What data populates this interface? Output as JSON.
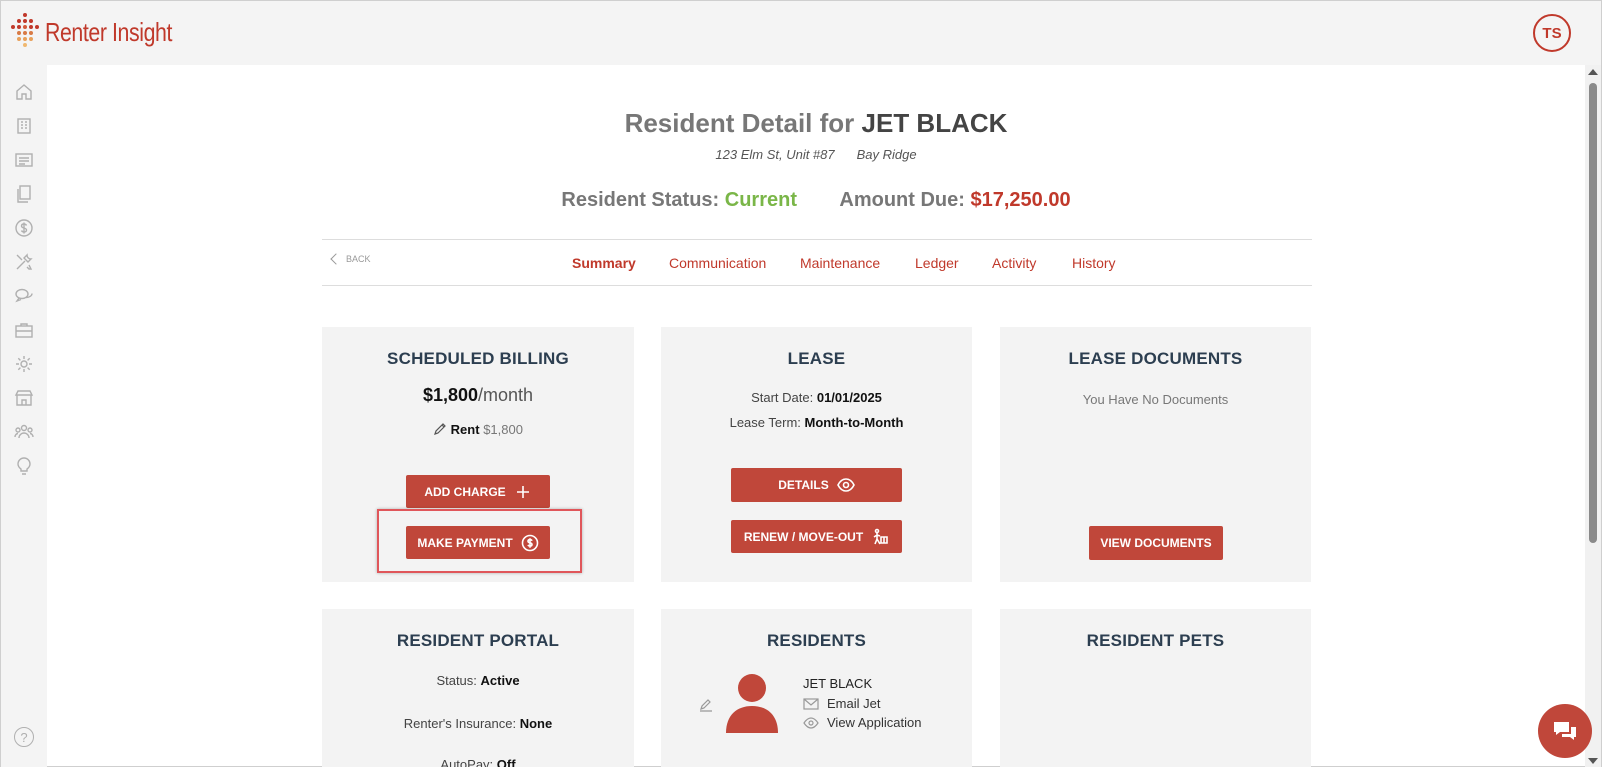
{
  "app": {
    "name": "Renter Insight",
    "user_initials": "TS"
  },
  "colors": {
    "accent": "#c0392b",
    "status_current": "#7ab648",
    "sidebar_bg": "#f4f4f4",
    "card_bg": "#f3f3f3"
  },
  "sidebar": {
    "icons": [
      "home-icon",
      "building-icon",
      "list-icon",
      "documents-icon",
      "dollar-icon",
      "tools-icon",
      "chat-icon",
      "briefcase-icon",
      "gear-icon",
      "store-icon",
      "people-icon",
      "lightbulb-icon"
    ],
    "help_label": "?"
  },
  "header": {
    "title_prefix": "Resident Detail for",
    "resident_name": "JET BLACK",
    "address": "123 Elm St, Unit #87",
    "neighborhood": "Bay Ridge",
    "status_label": "Resident Status:",
    "status_value": "Current",
    "amount_label": "Amount Due:",
    "amount_value": "$17,250.00"
  },
  "tabs": {
    "back_label": "BACK",
    "items": [
      "Summary",
      "Communication",
      "Maintenance",
      "Ledger",
      "Activity",
      "History"
    ],
    "active": "Summary"
  },
  "scheduled_billing": {
    "title": "SCHEDULED BILLING",
    "amount": "$1,800",
    "period": "/month",
    "rent_label": "Rent",
    "rent_amount": "$1,800",
    "add_charge_label": "ADD CHARGE",
    "make_payment_label": "MAKE PAYMENT"
  },
  "lease": {
    "title": "LEASE",
    "start_label": "Start Date:",
    "start_value": "01/01/2025",
    "term_label": "Lease Term:",
    "term_value": "Month-to-Month",
    "details_label": "DETAILS",
    "renew_label": "RENEW / MOVE-OUT"
  },
  "lease_documents": {
    "title": "LEASE DOCUMENTS",
    "empty_text": "You Have No Documents",
    "view_label": "VIEW DOCUMENTS"
  },
  "resident_portal": {
    "title": "RESIDENT PORTAL",
    "status_label": "Status:",
    "status_value": "Active",
    "insurance_label": "Renter's Insurance:",
    "insurance_value": "None",
    "autopay_label": "AutoPay:",
    "autopay_value": "Off"
  },
  "residents": {
    "title": "RESIDENTS",
    "name": "JET BLACK",
    "email_label": "Email Jet",
    "application_label": "View Application"
  },
  "resident_pets": {
    "title": "RESIDENT PETS"
  }
}
